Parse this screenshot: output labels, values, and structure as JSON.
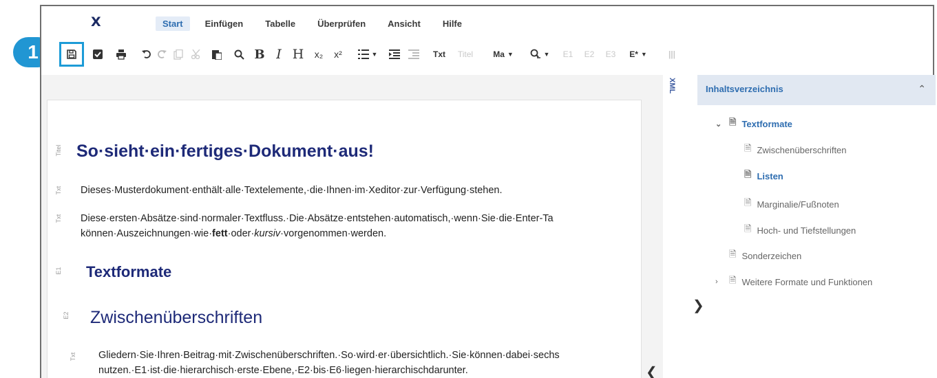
{
  "app": {
    "logo": "X"
  },
  "menu": [
    "Start",
    "Einfügen",
    "Tabelle",
    "Überprüfen",
    "Ansicht",
    "Hilfe"
  ],
  "badge": "1",
  "toolbar": {
    "italic": "I",
    "heading": "H",
    "subscript": "x₂",
    "superscript": "x²",
    "txt": "Txt",
    "titel": "Titel",
    "ma": "Ma",
    "e1": "E1",
    "e2": "E2",
    "e3": "E3",
    "estar": "E*",
    "more": "|||"
  },
  "editor": {
    "tags": {
      "titel": "Titel",
      "txt": "Txt",
      "e1": "E1",
      "e2": "E2"
    },
    "title": "So·sieht·ein·fertiges·Dokument·aus!",
    "p1": "Dieses·Musterdokument·enthält·alle·Textelemente,·die·Ihnen·im·Xeditor·zur·Verfügung·stehen.",
    "p2": "Diese·ersten·Absätze·sind·normaler·Textfluss.·Die·Absätze·entstehen·automatisch,·wenn·Sie·die·Enter-Ta",
    "p3a": "können·Auszeichnungen·wie·",
    "p3b": "fett",
    "p3c": "·oder·",
    "p3d": "kursiv",
    "p3e": "·vorgenommen·werden.",
    "h1": "Textformate",
    "h2": "Zwischenüberschriften",
    "p4": "Gliedern·Sie·Ihren·Beitrag·mit·Zwischenüberschriften.·So·wird·er·übersichtlich.·Sie·können·dabei·sechs",
    "p5": "nutzen.·E1·ist·die·hierarchisch·erste·Ebene,·E2·bis·E6·liegen·hierarchischdarunter."
  },
  "side": {
    "xml": "XML",
    "title": "Inhaltsverzeichnis",
    "items": [
      "Textformate",
      "Zwischenüberschriften",
      "Listen",
      "Marginalie/Fußnoten",
      "Hoch- und Tiefstellungen",
      "Sonderzeichen",
      "Weitere Formate und Funktionen"
    ]
  }
}
